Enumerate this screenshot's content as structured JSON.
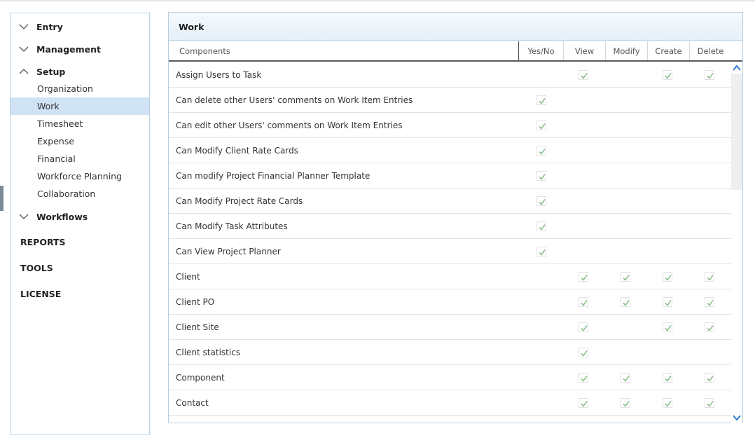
{
  "sidebar": {
    "groups": [
      {
        "label": "Entry",
        "expanded": false
      },
      {
        "label": "Management",
        "expanded": false
      },
      {
        "label": "Setup",
        "expanded": true
      },
      {
        "label": "Workflows",
        "expanded": false
      }
    ],
    "setup_items": [
      "Organization",
      "Work",
      "Timesheet",
      "Expense",
      "Financial",
      "Workforce Planning",
      "Collaboration"
    ],
    "active_item": "Work",
    "links": [
      "REPORTS",
      "TOOLS",
      "LICENSE"
    ]
  },
  "panel": {
    "title": "Work",
    "columns": {
      "components": "Components",
      "yesno": "Yes/No",
      "view": "View",
      "modify": "Modify",
      "create": "Create",
      "delete": "Delete"
    },
    "rows": [
      {
        "name": "Assign Users to Task",
        "yesno": false,
        "view": true,
        "modify": false,
        "create": true,
        "delete": true
      },
      {
        "name": "Can delete other Users' comments on Work Item Entries",
        "yesno": true,
        "view": false,
        "modify": false,
        "create": false,
        "delete": false
      },
      {
        "name": "Can edit other Users' comments on Work Item Entries",
        "yesno": true,
        "view": false,
        "modify": false,
        "create": false,
        "delete": false
      },
      {
        "name": "Can Modify Client Rate Cards",
        "yesno": true,
        "view": false,
        "modify": false,
        "create": false,
        "delete": false
      },
      {
        "name": "Can modify Project Financial Planner Template",
        "yesno": true,
        "view": false,
        "modify": false,
        "create": false,
        "delete": false
      },
      {
        "name": "Can Modify Project Rate Cards",
        "yesno": true,
        "view": false,
        "modify": false,
        "create": false,
        "delete": false
      },
      {
        "name": "Can Modify Task Attributes",
        "yesno": true,
        "view": false,
        "modify": false,
        "create": false,
        "delete": false
      },
      {
        "name": "Can View Project Planner",
        "yesno": true,
        "view": false,
        "modify": false,
        "create": false,
        "delete": false
      },
      {
        "name": "Client",
        "yesno": false,
        "view": true,
        "modify": true,
        "create": true,
        "delete": true
      },
      {
        "name": "Client PO",
        "yesno": false,
        "view": true,
        "modify": true,
        "create": true,
        "delete": true
      },
      {
        "name": "Client Site",
        "yesno": false,
        "view": true,
        "modify": false,
        "create": true,
        "delete": true
      },
      {
        "name": "Client statistics",
        "yesno": false,
        "view": true,
        "modify": false,
        "create": false,
        "delete": false
      },
      {
        "name": "Component",
        "yesno": false,
        "view": true,
        "modify": true,
        "create": true,
        "delete": true
      },
      {
        "name": "Contact",
        "yesno": false,
        "view": true,
        "modify": true,
        "create": true,
        "delete": true
      },
      {
        "name": "",
        "yesno": false,
        "view": true,
        "modify": true,
        "create": true,
        "delete": true
      }
    ]
  },
  "colors": {
    "accent": "#cfe3f5",
    "border": "#b9d3e6",
    "check": "#8fc08f"
  }
}
